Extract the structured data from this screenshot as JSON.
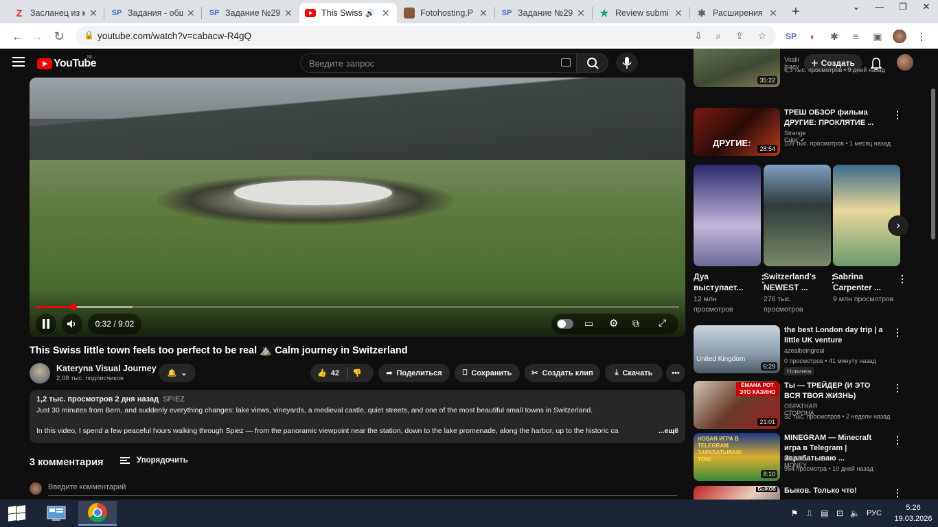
{
  "browser": {
    "tabs": [
      {
        "label": "Засланец из к",
        "favicon": "Z",
        "favcolor": "#e31b23"
      },
      {
        "label": "Задания - общ",
        "favicon": "SP",
        "favcolor": "#3f6cc8"
      },
      {
        "label": "Задание №29",
        "favicon": "SP",
        "favcolor": "#3f6cc8"
      },
      {
        "label": "This Swiss",
        "favicon": "youtube-icon",
        "favcolor": "#ff0000",
        "active": true
      },
      {
        "label": "Fotohosting.Р",
        "favicon": "photo-icon",
        "favcolor": "#8a5a3a"
      },
      {
        "label": "Задание №29",
        "favicon": "SP",
        "favcolor": "#3f6cc8"
      },
      {
        "label": "Review submi",
        "favicon": "star-icon",
        "favcolor": "#0fa968"
      },
      {
        "label": "Расширения",
        "favicon": "puzzle-icon",
        "favcolor": "#5f6368"
      }
    ],
    "new_tab": "+",
    "url": "youtube.com/watch?v=cabacw-R4gQ"
  },
  "youtube": {
    "logo": "YouTube",
    "country": "NL",
    "search_placeholder": "Введите запрос",
    "create_label": "Создать",
    "video": {
      "current_time": "0:32",
      "duration": "9:02",
      "progress": 0.059,
      "buffered": 0.15,
      "title": "This Swiss little town feels too perfect to be real ⛰️ Calm journey in Switzerland",
      "channel": "Kateryna Visual Journey",
      "subscribers": "2,08 тыс. подписчиков",
      "likes": "42",
      "share": "Поделиться",
      "save": "Сохранить",
      "clip": "Создать клип",
      "download": "Скачать",
      "views_date": "1,2 тыс. просмотров  2 дня назад",
      "location_tag": "SPIEZ",
      "desc_line1": "Just 30 minutes from Bern, and suddenly everything changes: lake views, vineyards, a medieval castle, quiet streets, and one of the most beautiful small towns in Switzerland.",
      "desc_line2": "In this video, I spend a few peaceful hours walking through Spiez — from the panoramic viewpoint near the station, down to the lake promenade, along the harbor, up to the historic ca",
      "more": "...ещё"
    },
    "comments": {
      "count": "3 комментария",
      "sort": "Упорядочить",
      "placeholder": "Введите комментарий"
    },
    "sidebar": {
      "top": {
        "channel": "Vitalii Isaev",
        "meta": "6,3 тыс. просмотров • 9 дней назад",
        "duration": "35:22"
      },
      "videos": [
        {
          "title": "ТРЕШ ОБЗОР фильма ДРУГИЕ: ПРОКЛЯТИЕ ...",
          "channel": "Strange Critic",
          "meta": "109 тыс. просмотров • 1 месяц назад",
          "duration": "28:54",
          "thumb_text": "ДРУГИЕ:"
        },
        {
          "title": "the best London day trip | a little UK venture",
          "channel": "azealbeingreal",
          "meta": "0 просмотров • 41 минуту назад",
          "duration": "6:29",
          "badge": "Новинка",
          "thumb_text": "United Kingdom"
        },
        {
          "title": "Ты — ТРЕЙДЕР (И ЭТО ВСЯ ТВОЯ ЖИЗНЬ)",
          "channel": "ОБРАТНАЯ СТОРОНА",
          "meta": "32 тыс. просмотров • 2 недели назад",
          "duration": "21:01",
          "thumb_text": "ЁМАНА РОТ ЭТО КАЗИНО"
        },
        {
          "title": "MINEGRAM — Minecraft игра в Telegram | Зарабатываю ...",
          "channel": "KNAZEV MONEY",
          "meta": "954 просмотра • 10 дней назад",
          "duration": "8:10",
          "thumb_text": "НОВАЯ ИГРА В TELEGRAM ЗАРАБАТЫВАЮ TON!"
        },
        {
          "title": "Быков. Только что!",
          "thumb_text": "БЫКОВ"
        }
      ],
      "shorts": [
        {
          "title": "Дуа выступает...",
          "meta": "12 млн просмотров"
        },
        {
          "title": "Switzerland's NEWEST ...",
          "meta": "276 тыс. просмотров"
        },
        {
          "title": "Sabrina Carpenter ...",
          "meta": "9 млн просмотров"
        }
      ]
    }
  },
  "taskbar": {
    "lang": "РУС",
    "time": "5:26",
    "date": "19.03.2026"
  },
  "colors": {
    "accent": "#ff0000",
    "bg": "#0f0f0f",
    "chip": "#272727"
  }
}
